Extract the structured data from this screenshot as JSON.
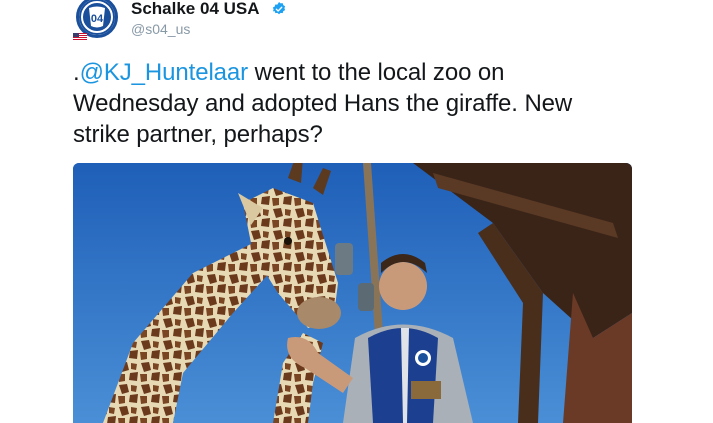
{
  "account": {
    "display_name": "Schalke 04 USA",
    "handle": "@s04_us",
    "verified": true,
    "avatar_text": "04",
    "brand_color": "#1a4f9c"
  },
  "tweet": {
    "prefix": ".",
    "mention": "@KJ_Huntelaar",
    "body": " went to the local zoo on Wednesday and adopted Hans the giraffe. New strike partner, perhaps?",
    "mention_color": "#1b95e0"
  },
  "media": {
    "type": "photo",
    "subject": "giraffe-and-player-photo"
  }
}
